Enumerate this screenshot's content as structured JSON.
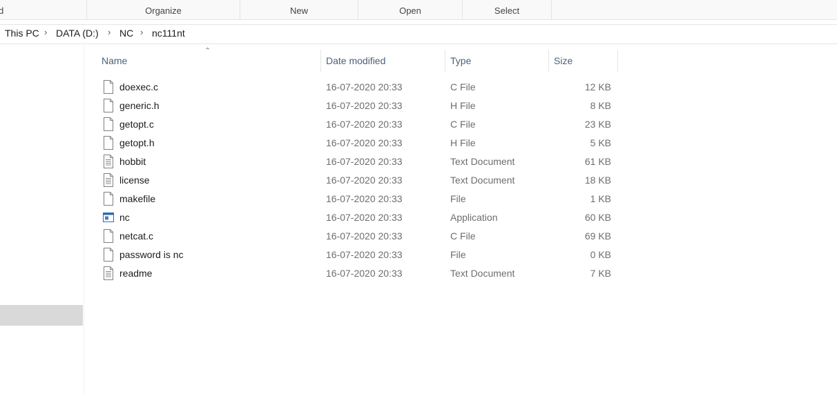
{
  "ribbon": {
    "cut_label": "d",
    "organize": "Organize",
    "new": "New",
    "open": "Open",
    "select": "Select"
  },
  "address": {
    "crumbs": [
      "This PC",
      "DATA (D:)",
      "NC",
      "nc111nt"
    ],
    "separator": ">"
  },
  "columns": {
    "name": "Name",
    "date": "Date modified",
    "type": "Type",
    "size": "Size",
    "sort_indicator": "^"
  },
  "files": [
    {
      "name": "doexec.c",
      "date": "16-07-2020 20:33",
      "type": "C File",
      "size": "12 KB",
      "icon": "blank-file-icon"
    },
    {
      "name": "generic.h",
      "date": "16-07-2020 20:33",
      "type": "H File",
      "size": "8 KB",
      "icon": "blank-file-icon"
    },
    {
      "name": "getopt.c",
      "date": "16-07-2020 20:33",
      "type": "C File",
      "size": "23 KB",
      "icon": "blank-file-icon"
    },
    {
      "name": "getopt.h",
      "date": "16-07-2020 20:33",
      "type": "H File",
      "size": "5 KB",
      "icon": "blank-file-icon"
    },
    {
      "name": "hobbit",
      "date": "16-07-2020 20:33",
      "type": "Text Document",
      "size": "61 KB",
      "icon": "text-document-icon"
    },
    {
      "name": "license",
      "date": "16-07-2020 20:33",
      "type": "Text Document",
      "size": "18 KB",
      "icon": "text-document-icon"
    },
    {
      "name": "makefile",
      "date": "16-07-2020 20:33",
      "type": "File",
      "size": "1 KB",
      "icon": "blank-file-icon"
    },
    {
      "name": "nc",
      "date": "16-07-2020 20:33",
      "type": "Application",
      "size": "60 KB",
      "icon": "application-icon"
    },
    {
      "name": "netcat.c",
      "date": "16-07-2020 20:33",
      "type": "C File",
      "size": "69 KB",
      "icon": "blank-file-icon"
    },
    {
      "name": "password is nc",
      "date": "16-07-2020 20:33",
      "type": "File",
      "size": "0 KB",
      "icon": "blank-file-icon"
    },
    {
      "name": "readme",
      "date": "16-07-2020 20:33",
      "type": "Text Document",
      "size": "7 KB",
      "icon": "text-document-icon"
    }
  ],
  "colors": {
    "header_text": "#4c607a",
    "secondary_text": "#6d6d6d",
    "nav_selected": "#d9d9d9"
  }
}
